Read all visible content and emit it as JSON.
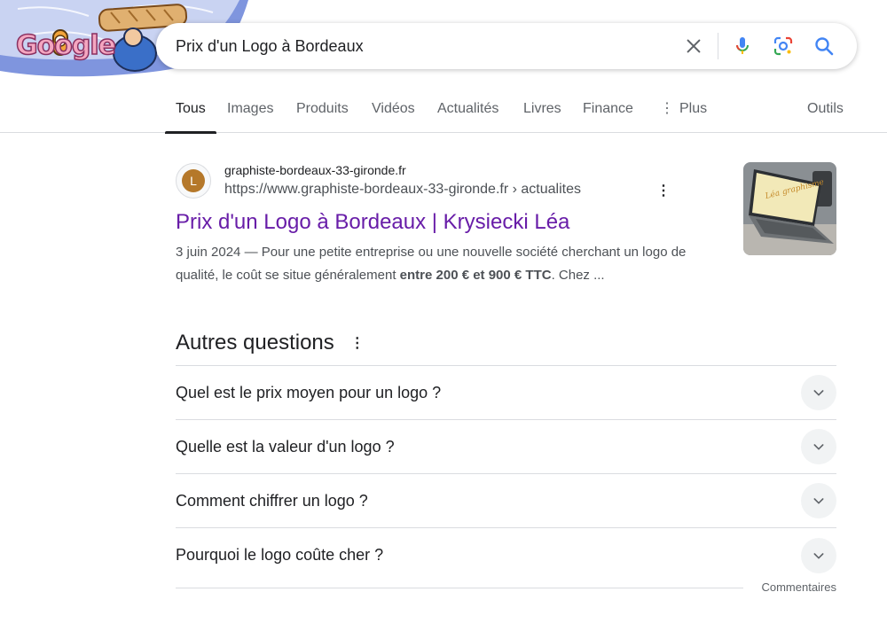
{
  "search": {
    "query": "Prix d'un Logo à Bordeaux",
    "clear_icon": "close-icon",
    "voice_icon": "mic-icon",
    "lens_icon": "camera-lens-icon",
    "search_icon": "search-icon"
  },
  "doodle": {
    "text": "Google"
  },
  "tabs": [
    {
      "label": "Tous",
      "active": true
    },
    {
      "label": "Images"
    },
    {
      "label": "Produits"
    },
    {
      "label": "Vidéos"
    },
    {
      "label": "Actualités"
    },
    {
      "label": "Livres"
    },
    {
      "label": "Finance"
    },
    {
      "label": "Plus"
    }
  ],
  "tools_label": "Outils",
  "result": {
    "favicon_letter": "L",
    "site_name": "graphiste-bordeaux-33-gironde.fr",
    "url": "https://www.graphiste-bordeaux-33-gironde.fr › actualites",
    "title": "Prix d'un Logo à Bordeaux | Krysiecki Léa",
    "snippet_before": "3 juin 2024 — Pour une petite entreprise ou une nouvelle société cherchant un logo de qualité, le coût se situe généralement ",
    "snippet_bold": "entre 200 € et 900 € TTC",
    "snippet_after": ". Chez ...",
    "thumbnail_text": "Léa graphisme"
  },
  "paa": {
    "heading": "Autres questions",
    "questions": [
      "Quel est le prix moyen pour un logo ?",
      "Quelle est la valeur d'un logo ?",
      "Comment chiffrer un logo ?",
      "Pourquoi le logo coûte cher ?"
    ],
    "feedback": "Commentaires"
  },
  "colors": {
    "visited_link": "#681da8",
    "text": "#202124",
    "muted": "#4d5156",
    "favicon_bg": "#b5782a"
  }
}
